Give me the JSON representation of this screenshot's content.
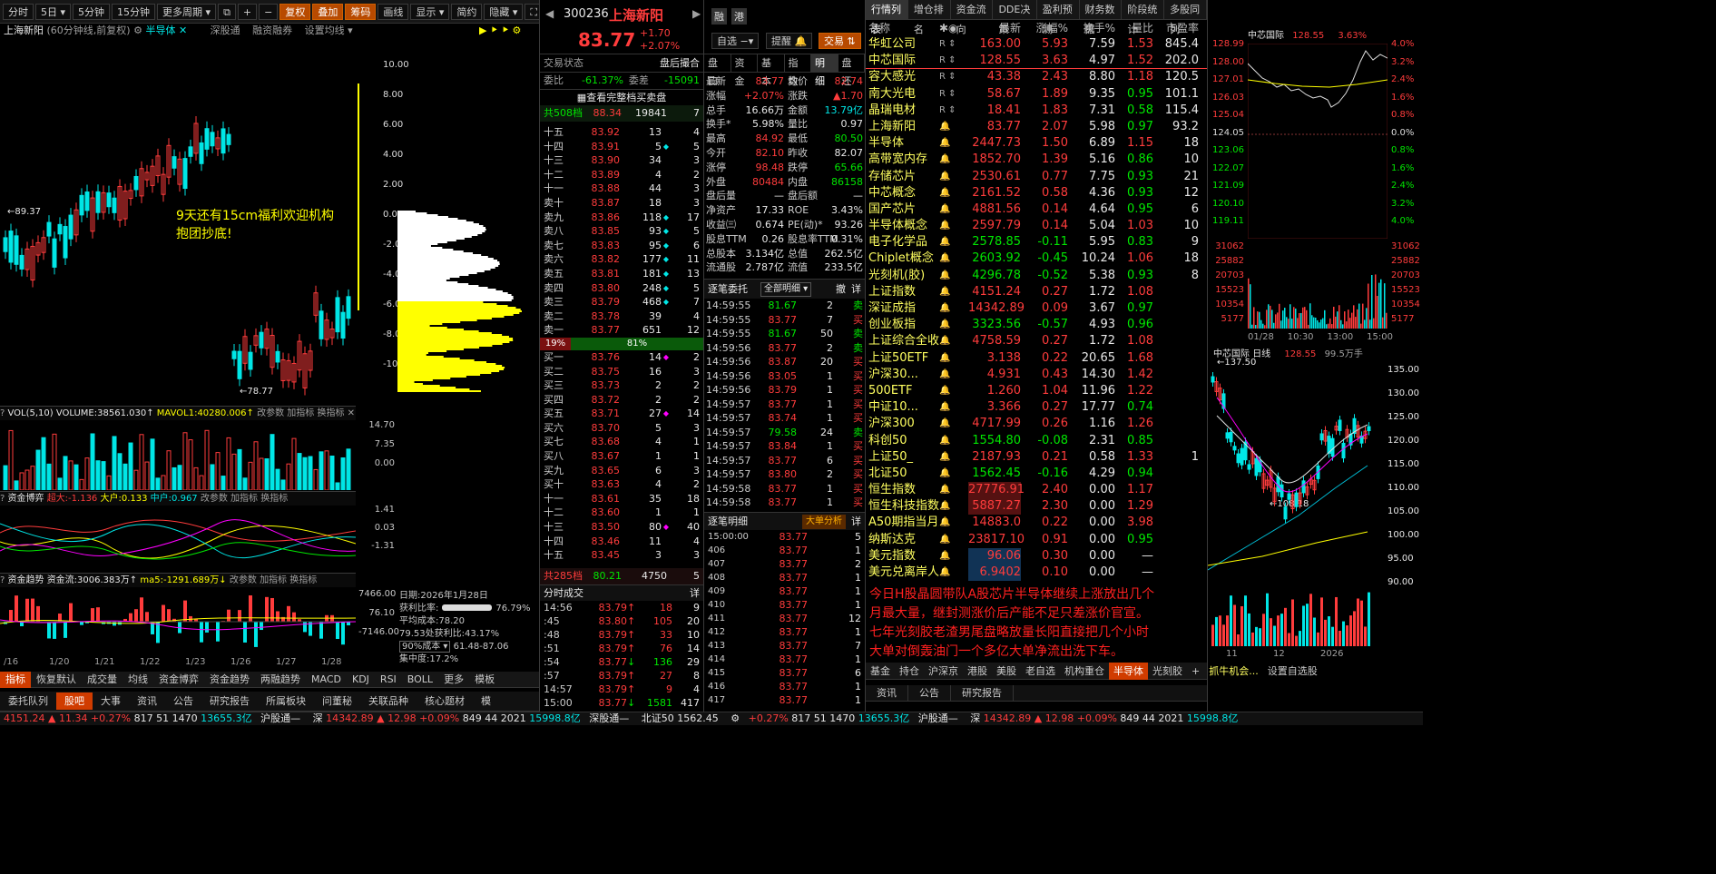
{
  "chart_toolbar": {
    "periods": [
      "分时",
      "5日",
      "5分钟",
      "15分钟",
      "更多周期"
    ],
    "tools": [
      "复权",
      "叠加",
      "筹码",
      "画线",
      "显示",
      "简约",
      "隐藏"
    ]
  },
  "chart_info": {
    "name": "上海新阳",
    "desc": "(60分钟线,前复权)",
    "sector": "半导体",
    "links": [
      "深股通",
      "融资融券",
      "设置均线"
    ]
  },
  "price_axis": [
    "10.00",
    "8.00",
    "6.00",
    "4.00",
    "2.00",
    "0.00",
    "-2.00",
    "-4.00",
    "-6.00",
    "-8.00",
    "-10.00"
  ],
  "hi_label": "←89.37",
  "lo_label": "←78.77",
  "annotation": [
    "9天还有15cm福利欢迎机构",
    "抱团抄底!"
  ],
  "vol": {
    "title": "VOL(5,10)",
    "volume": "VOLUME:38561.030",
    "mavol": "MAVOL1:40280.006",
    "axis": [
      "14.70",
      "7.35",
      "0.00"
    ],
    "links": [
      "改参数",
      "加指标",
      "换指标"
    ]
  },
  "fund": {
    "title": "资金博弈",
    "super": "超大:-1.136",
    "big": "大户:0.133",
    "mid": "中户:0.967",
    "axis": [
      "1.41",
      "0.03",
      "-1.31"
    ]
  },
  "trend": {
    "title": "资金趋势",
    "flow": "资金流:3006.383万",
    "ma5": "ma5:-1291.689万",
    "axis": [
      "7466.00",
      "76.10",
      "-7146.00"
    ]
  },
  "dates": [
    "/16",
    "1/20",
    "1/21",
    "1/22",
    "1/23",
    "1/26",
    "1/27",
    "1/28"
  ],
  "chip": {
    "date": "日期:2026年1月28日",
    "profit_label": "获利比率:",
    "profit": "76.79%",
    "avgcost": "平均成本:78.20",
    "cost_note": "79.53处获利比:43.17%",
    "range_sel": "90%成本",
    "range": "61.48-87.06",
    "concentration": "集中度:17.2%"
  },
  "bottom_tabs": [
    "指标",
    "恢复默认",
    "成交量",
    "均线",
    "资金博弈",
    "资金趋势",
    "两融趋势",
    "MACD",
    "KDJ",
    "RSI",
    "BOLL",
    "更多",
    "模板"
  ],
  "bottom_tabs2": [
    "委托队列",
    "股吧",
    "大事",
    "资讯",
    "公告",
    "研究报告",
    "所属板块",
    "问董秘",
    "关联品种",
    "核心题材",
    "模"
  ],
  "stock": {
    "code": "300236",
    "name": "上海新阳",
    "price": "83.77",
    "chg": "+1.70",
    "pct": "+2.07%",
    "tags": [
      "融",
      "港"
    ],
    "buttons": [
      "自选",
      "提醒",
      "交易"
    ]
  },
  "trade_status": {
    "label": "交易状态",
    "value": "盘后撮合",
    "wb_label": "委比",
    "wb": "-61.37%",
    "wc_label": "委差",
    "wc": "-15091",
    "full": "查看完整档买卖盘"
  },
  "sell_total": {
    "label": "共508档",
    "price": "88.34",
    "vol": "19841",
    "n": "7"
  },
  "sells": [
    [
      "十五",
      "83.92",
      "13",
      "4"
    ],
    [
      "十四",
      "83.91",
      "5",
      "5"
    ],
    [
      "十三",
      "83.90",
      "34",
      "3"
    ],
    [
      "十二",
      "83.89",
      "4",
      "2"
    ],
    [
      "十一",
      "83.88",
      "44",
      "3"
    ],
    [
      "卖十",
      "83.87",
      "18",
      "3"
    ],
    [
      "卖九",
      "83.86",
      "118",
      "17"
    ],
    [
      "卖八",
      "83.85",
      "93",
      "5"
    ],
    [
      "卖七",
      "83.83",
      "95",
      "6"
    ],
    [
      "卖六",
      "83.82",
      "177",
      "11"
    ],
    [
      "卖五",
      "83.81",
      "181",
      "13"
    ],
    [
      "卖四",
      "83.80",
      "248",
      "5"
    ],
    [
      "卖三",
      "83.79",
      "468",
      "7"
    ],
    [
      "卖二",
      "83.78",
      "39",
      "4"
    ],
    [
      "卖一",
      "83.77",
      "651",
      "12"
    ]
  ],
  "ratio": [
    "19%",
    "81%"
  ],
  "buys": [
    [
      "买一",
      "83.76",
      "14",
      "2"
    ],
    [
      "买二",
      "83.75",
      "16",
      "3"
    ],
    [
      "买三",
      "83.73",
      "2",
      "2"
    ],
    [
      "买四",
      "83.72",
      "2",
      "2"
    ],
    [
      "买五",
      "83.71",
      "27",
      "14"
    ],
    [
      "买六",
      "83.70",
      "5",
      "3"
    ],
    [
      "买七",
      "83.68",
      "4",
      "1"
    ],
    [
      "买八",
      "83.67",
      "1",
      "1"
    ],
    [
      "买九",
      "83.65",
      "6",
      "3"
    ],
    [
      "买十",
      "83.63",
      "4",
      "2"
    ],
    [
      "十一",
      "83.61",
      "35",
      "18"
    ],
    [
      "十二",
      "83.60",
      "1",
      "1"
    ],
    [
      "十三",
      "83.50",
      "80",
      "40"
    ],
    [
      "十四",
      "83.46",
      "11",
      "4"
    ],
    [
      "十五",
      "83.45",
      "3",
      "3"
    ]
  ],
  "buy_total": {
    "label": "共285档",
    "price": "80.21",
    "vol": "4750",
    "n": "5"
  },
  "ticks_header": "分时成交",
  "ticks": [
    [
      "14:56",
      "83.79",
      "18",
      "9"
    ],
    [
      ":45",
      "83.80",
      "105",
      "20"
    ],
    [
      ":48",
      "83.79",
      "33",
      "10"
    ],
    [
      ":51",
      "83.79",
      "76",
      "14"
    ],
    [
      ":54",
      "83.77",
      "136",
      "29"
    ],
    [
      ":57",
      "83.79",
      "27",
      "8"
    ],
    [
      "14:57",
      "83.79",
      "9",
      "4"
    ],
    [
      "15:00",
      "83.77",
      "1581",
      "417"
    ]
  ],
  "info_tabs": [
    "盘口",
    "资金",
    "基本",
    "指数",
    "明细",
    "盘还"
  ],
  "quote": [
    [
      "最新",
      "83.77",
      "均价",
      "82.74"
    ],
    [
      "涨幅",
      "+2.07%",
      "涨跌",
      "▲1.70"
    ],
    [
      "总手",
      "16.66万",
      "金额",
      "13.79亿"
    ],
    [
      "换手*",
      "5.98%",
      "量比",
      "0.97"
    ],
    [
      "最高",
      "84.92",
      "最低",
      "80.50"
    ],
    [
      "今开",
      "82.10",
      "昨收",
      "82.07"
    ],
    [
      "涨停",
      "98.48",
      "跌停",
      "65.66"
    ],
    [
      "外盘",
      "80484",
      "内盘",
      "86158"
    ],
    [
      "盘后量",
      "—",
      "盘后额",
      "—"
    ],
    [
      "净资产",
      "17.33",
      "ROE",
      "3.43%"
    ],
    [
      "收益㈢",
      "0.674",
      "PE(动)*",
      "93.26"
    ],
    [
      "股息TTM",
      "0.26",
      "股息率TTM",
      "0.31%"
    ],
    [
      "总股本",
      "3.134亿",
      "总值",
      "262.5亿"
    ],
    [
      "流通股",
      "2.787亿",
      "流值",
      "233.5亿"
    ]
  ],
  "orders_header": {
    "title": "逐笔委托",
    "sel": "全部明细",
    "btn1": "撤",
    "btn2": "详"
  },
  "orders": [
    [
      "14:59:55",
      "81.67",
      "2",
      "卖"
    ],
    [
      "14:59:55",
      "83.77",
      "7",
      "买"
    ],
    [
      "14:59:55",
      "81.67",
      "50",
      "卖"
    ],
    [
      "14:59:56",
      "83.77",
      "2",
      "卖"
    ],
    [
      "14:59:56",
      "83.87",
      "20",
      "买"
    ],
    [
      "14:59:56",
      "83.05",
      "1",
      "买"
    ],
    [
      "14:59:56",
      "83.79",
      "1",
      "买"
    ],
    [
      "14:59:57",
      "83.77",
      "1",
      "买"
    ],
    [
      "14:59:57",
      "83.74",
      "1",
      "买"
    ],
    [
      "14:59:57",
      "79.58",
      "24",
      "卖"
    ],
    [
      "14:59:57",
      "83.84",
      "1",
      "买"
    ],
    [
      "14:59:57",
      "83.77",
      "6",
      "买"
    ],
    [
      "14:59:57",
      "83.80",
      "2",
      "买"
    ],
    [
      "14:59:58",
      "83.77",
      "1",
      "买"
    ],
    [
      "14:59:58",
      "83.77",
      "1",
      "买"
    ]
  ],
  "detail_header": {
    "title": "逐笔明细",
    "btn": "大单分析",
    "btn2": "详"
  },
  "details": [
    [
      "15:00:00",
      "83.77",
      "5"
    ],
    [
      "406",
      "83.77",
      "1"
    ],
    [
      "407",
      "83.77",
      "2"
    ],
    [
      "408",
      "83.77",
      "1"
    ],
    [
      "409",
      "83.77",
      "1"
    ],
    [
      "410",
      "83.77",
      "1"
    ],
    [
      "411",
      "83.77",
      "12"
    ],
    [
      "412",
      "83.77",
      "1"
    ],
    [
      "413",
      "83.77",
      "7"
    ],
    [
      "414",
      "83.77",
      "1"
    ],
    [
      "415",
      "83.77",
      "6"
    ],
    [
      "416",
      "83.77",
      "1"
    ],
    [
      "417",
      "83.77",
      "1"
    ]
  ],
  "list_tabs": [
    "行情列表",
    "增仓排名",
    "资金流向",
    "DDE决策",
    "盈利预测",
    "财务数据",
    "阶段统计",
    "多股同列"
  ],
  "list_cols": [
    "名称",
    "最新",
    "涨幅%",
    "换手%",
    "量比",
    "市盈率"
  ],
  "list": [
    [
      "华虹公司",
      "163.00",
      "5.93",
      "7.59",
      "1.53",
      "845.4"
    ],
    [
      "中芯国际",
      "128.55",
      "3.63",
      "4.97",
      "1.52",
      "202.0"
    ],
    [
      "容大感光",
      "43.38",
      "2.43",
      "8.80",
      "1.18",
      "120.5"
    ],
    [
      "南大光电",
      "58.67",
      "1.89",
      "9.35",
      "0.95",
      "101.1"
    ],
    [
      "晶瑞电材",
      "18.41",
      "1.83",
      "7.31",
      "0.58",
      "115.4"
    ],
    [
      "上海新阳",
      "83.77",
      "2.07",
      "5.98",
      "0.97",
      "93.2"
    ],
    [
      "半导体",
      "2447.73",
      "1.50",
      "6.89",
      "1.15",
      "18"
    ],
    [
      "高带宽内存",
      "1852.70",
      "1.39",
      "5.16",
      "0.86",
      "10"
    ],
    [
      "存储芯片",
      "2530.61",
      "0.77",
      "7.75",
      "0.93",
      "21"
    ],
    [
      "中芯概念",
      "2161.52",
      "0.58",
      "4.36",
      "0.93",
      "12"
    ],
    [
      "国产芯片",
      "4881.56",
      "0.14",
      "4.64",
      "0.95",
      "6"
    ],
    [
      "半导体概念",
      "2597.79",
      "0.14",
      "5.04",
      "1.03",
      "10"
    ],
    [
      "电子化学品",
      "2578.85",
      "-0.11",
      "5.95",
      "0.83",
      "9"
    ],
    [
      "Chiplet概念",
      "2603.92",
      "-0.45",
      "10.24",
      "1.06",
      "18"
    ],
    [
      "光刻机(胶)",
      "4296.78",
      "-0.52",
      "5.38",
      "0.93",
      "8"
    ],
    [
      "上证指数",
      "4151.24",
      "0.27",
      "1.72",
      "1.08",
      ""
    ],
    [
      "深证成指",
      "14342.89",
      "0.09",
      "3.67",
      "0.97",
      ""
    ],
    [
      "创业板指",
      "3323.56",
      "-0.57",
      "4.93",
      "0.96",
      ""
    ],
    [
      "上证综合全收益",
      "4758.59",
      "0.27",
      "1.72",
      "1.08",
      ""
    ],
    [
      "上证50ETF",
      "3.138",
      "0.22",
      "20.65",
      "1.68",
      ""
    ],
    [
      "沪深30...",
      "4.931",
      "0.43",
      "14.30",
      "1.42",
      ""
    ],
    [
      "500ETF",
      "1.260",
      "1.04",
      "11.96",
      "1.22",
      ""
    ],
    [
      "中证10...",
      "3.366",
      "0.27",
      "17.77",
      "0.74",
      ""
    ],
    [
      "沪深300",
      "4717.99",
      "0.26",
      "1.16",
      "1.26",
      ""
    ],
    [
      "科创50",
      "1554.80",
      "-0.08",
      "2.31",
      "0.85",
      ""
    ],
    [
      "上证50_",
      "2187.93",
      "0.21",
      "0.58",
      "1.33",
      "1"
    ],
    [
      "北证50",
      "1562.45",
      "-0.16",
      "4.29",
      "0.94",
      ""
    ],
    [
      "恒生指数",
      "27776.91",
      "2.40",
      "0.00",
      "1.17",
      ""
    ],
    [
      "恒生科技指数",
      "5887.27",
      "2.30",
      "0.00",
      "1.29",
      ""
    ],
    [
      "A50期指当月连续",
      "14883.0",
      "0.22",
      "0.00",
      "3.98",
      ""
    ],
    [
      "纳斯达克",
      "23817.10",
      "0.91",
      "0.00",
      "0.95",
      ""
    ],
    [
      "美元指数",
      "96.06",
      "0.30",
      "0.00",
      "—",
      ""
    ],
    [
      "美元兑离岸人民币",
      "6.9402",
      "0.10",
      "0.00",
      "—",
      ""
    ]
  ],
  "commentary": [
    "今日H股晶圆带队A股芯片半导体继续上涨放出几个",
    "月最大量，继封测涨价后产能不足只差涨价官宣。",
    "七年光刻胶老渣男尾盘略放量长阳直接把几个小时",
    "大单对倒轰油门一个多亿大单净流出洗下车。"
  ],
  "list_bottom_tabs": [
    "基金",
    "持仓",
    "沪深京",
    "港股",
    "美股",
    "老自选",
    "机构重仓",
    "半导体",
    "光刻胶",
    "+",
    "抓牛机会...",
    "设置自选股"
  ],
  "list_bottom_tabs2": [
    "资讯",
    "公告",
    "研究报告"
  ],
  "mini1": {
    "name": "中芯国际",
    "price": "128.55",
    "pct": "3.63%",
    "axis": [
      "128.99",
      "128.00",
      "127.01",
      "126.03",
      "125.04",
      "124.05",
      "123.06",
      "122.07",
      "121.09",
      "120.10",
      "119.11"
    ],
    "pct_axis": [
      "4.0%",
      "3.2%",
      "2.4%",
      "1.6%",
      "0.8%",
      "0.0%",
      "0.8%",
      "1.6%",
      "2.4%",
      "3.2%",
      "4.0%"
    ],
    "vol_axis": [
      "31062",
      "25882",
      "20703",
      "15523",
      "10354",
      "5177"
    ],
    "times": [
      "01/28",
      "10:30",
      "13:00",
      "15:00"
    ]
  },
  "mini2": {
    "name": "中芯国际",
    "period": "日线",
    "price": "128.55",
    "vol": "99.5万手",
    "hi": "←137.50",
    "lo": "←108.18",
    "axis": [
      "135.00",
      "130.00",
      "125.00",
      "120.00",
      "115.00",
      "110.00",
      "105.00",
      "100.00",
      "95.00",
      "90.00"
    ],
    "dates": [
      "11",
      "12",
      "2026"
    ]
  },
  "status": {
    "sh": "4151.24",
    "sh_chg": "▲ 11.34",
    "sh_pct": "+0.27%",
    "sh_n": "817",
    "n2": "51",
    "n3": "1470",
    "amt": "13655.3亿",
    "hgt": "沪股通",
    "sz_label": "深",
    "sz": "14342.89",
    "sz_chg": "▲ 12.98",
    "sz_pct": "+0.09%",
    "sz_n": "849",
    "n4": "44",
    "n5": "2021",
    "amt2": "15998.8亿",
    "sgt": "深股通",
    "bz_label": "北证50",
    "bz": "1562.45"
  },
  "colors": {
    "up": "#ff3c3c",
    "down": "#00e600",
    "accent": "#d03c00",
    "chip_yellow": "#ffff00",
    "candle_down": "#00e6e6"
  }
}
